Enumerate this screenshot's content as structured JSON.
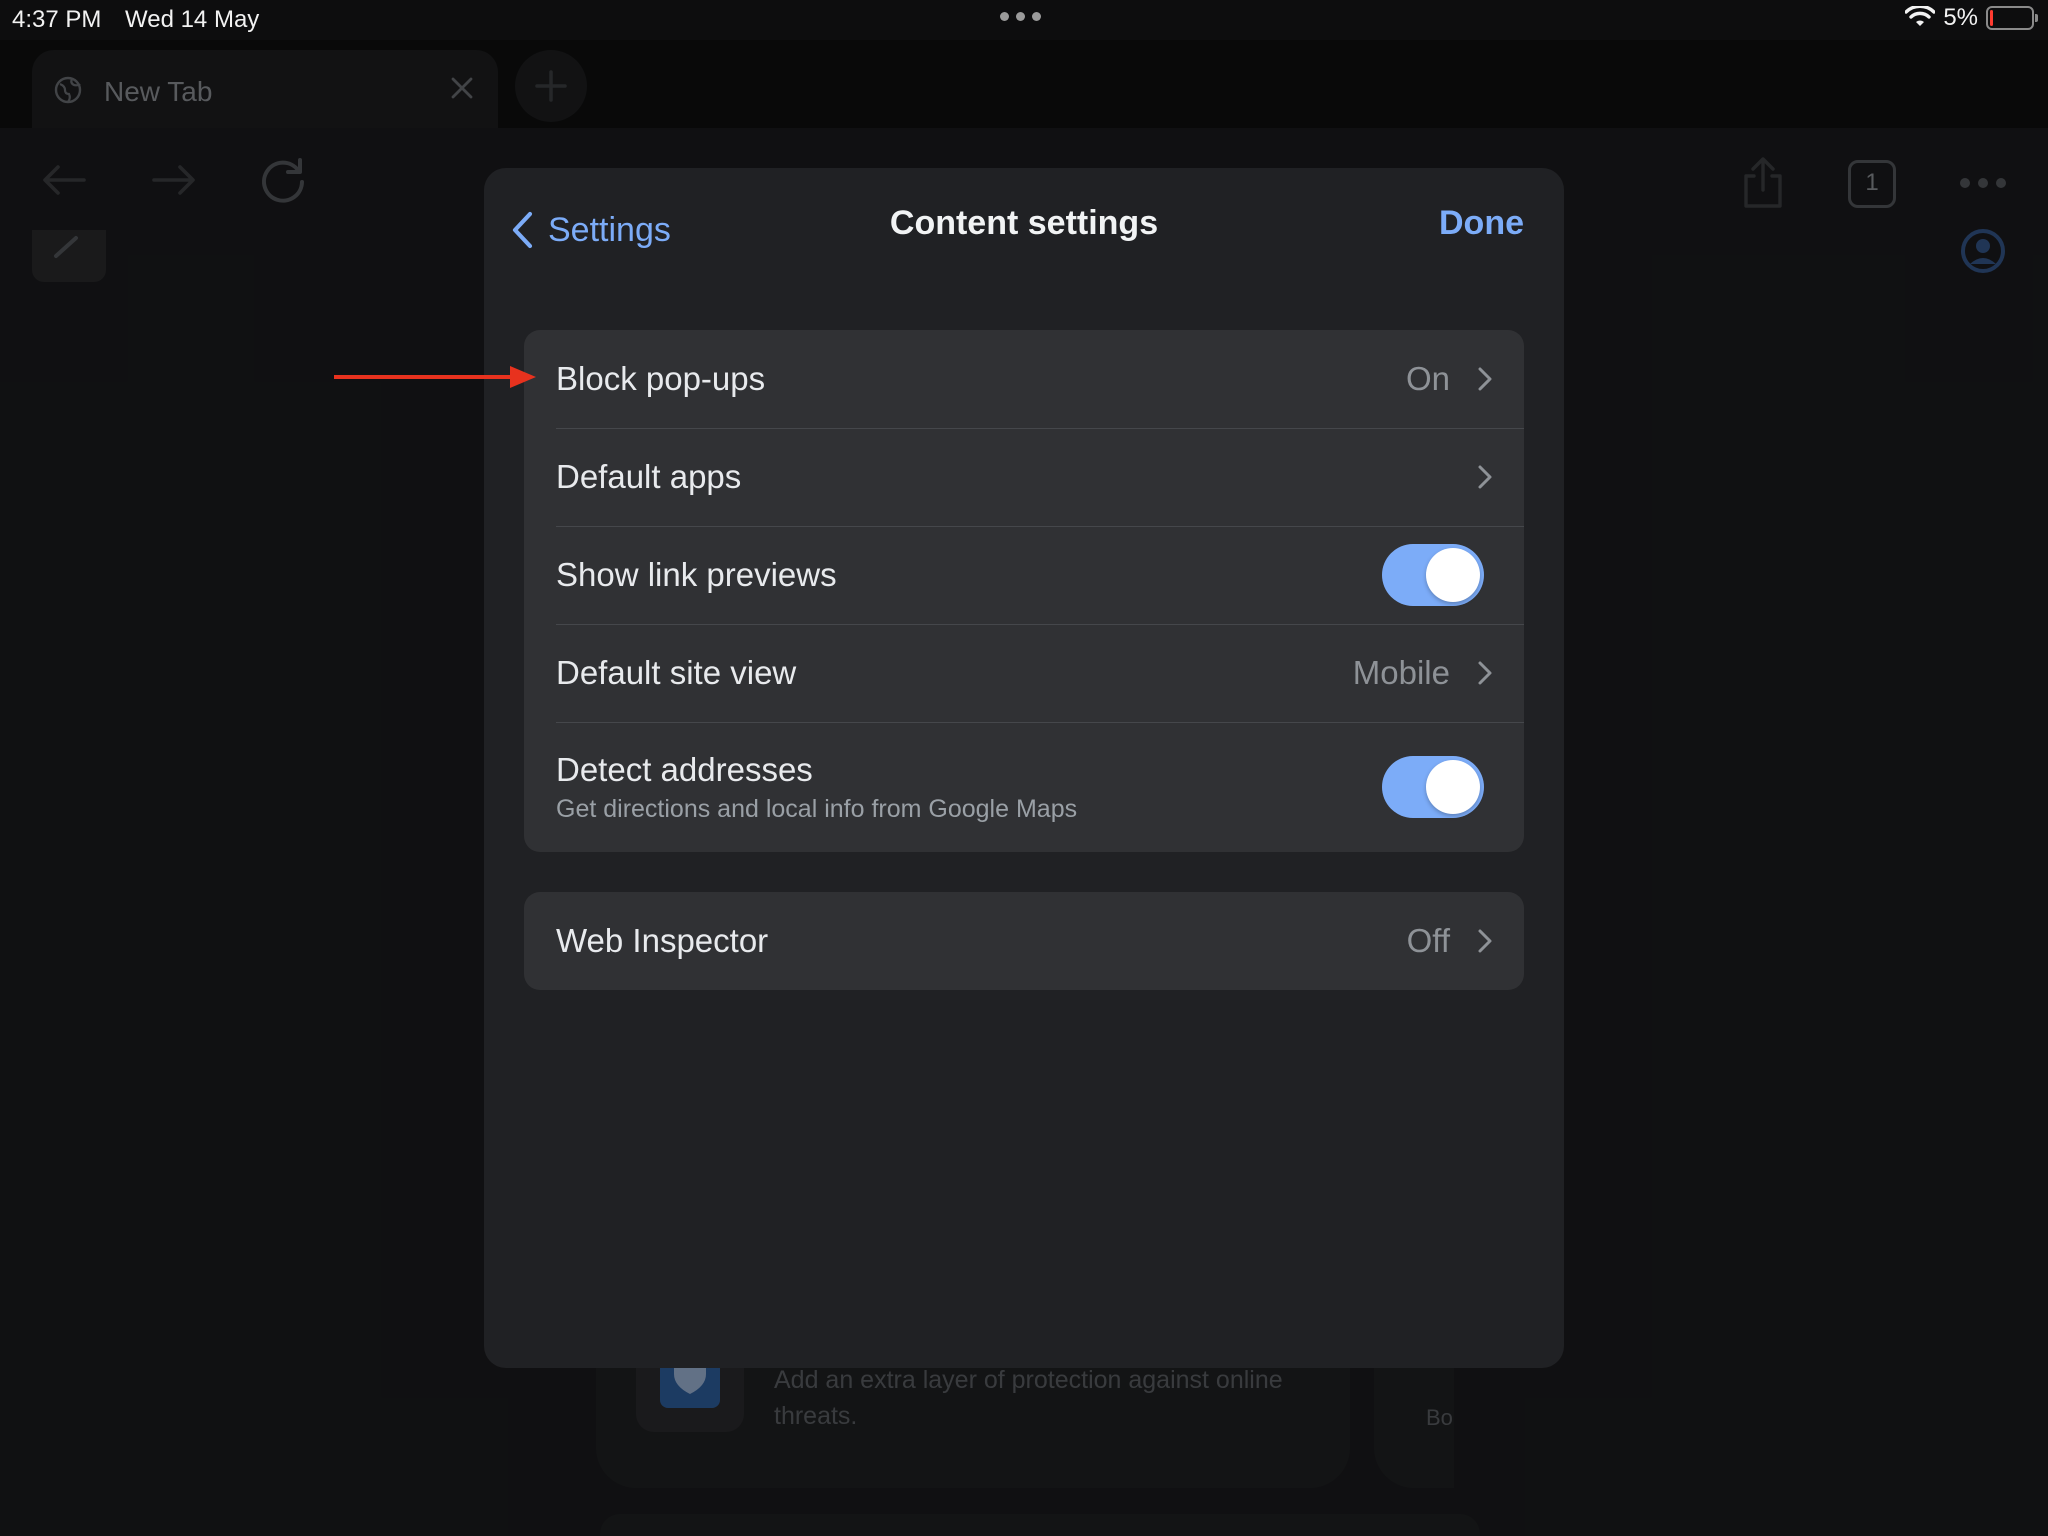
{
  "status_bar": {
    "time": "4:37 PM",
    "date": "Wed 14 May",
    "battery": "5%",
    "battery_level": 0.05,
    "icons": [
      "wifi-icon",
      "battery-icon",
      "more-dots-icon"
    ]
  },
  "browser": {
    "tab": {
      "title": "New Tab"
    },
    "tab_count": "1",
    "background_card": {
      "text": "Add an extra layer of protection against online threats.",
      "partial_text": "Bo"
    },
    "icons": [
      "globe-icon",
      "close-icon",
      "plus-icon",
      "back-arrow-icon",
      "forward-arrow-icon",
      "reload-icon",
      "share-icon",
      "tab-count-icon",
      "more-icon",
      "avatar-icon",
      "shield-icon"
    ]
  },
  "modal": {
    "back_label": "Settings",
    "title": "Content settings",
    "done_label": "Done",
    "colors": {
      "accent": "#7cacf8",
      "panel": "#202124",
      "row": "#303134",
      "annotation_arrow": "#e8321e"
    },
    "groups": [
      {
        "rows": [
          {
            "label": "Block pop-ups",
            "value": "On",
            "control": "chevron"
          },
          {
            "label": "Default apps",
            "value": "",
            "control": "chevron"
          },
          {
            "label": "Show link previews",
            "control": "toggle",
            "checked": true
          },
          {
            "label": "Default site view",
            "value": "Mobile",
            "control": "chevron"
          },
          {
            "label": "Detect addresses",
            "subtitle": "Get directions and local info from Google Maps",
            "control": "toggle",
            "checked": true
          }
        ]
      },
      {
        "rows": [
          {
            "label": "Web Inspector",
            "value": "Off",
            "control": "chevron"
          }
        ]
      }
    ]
  }
}
